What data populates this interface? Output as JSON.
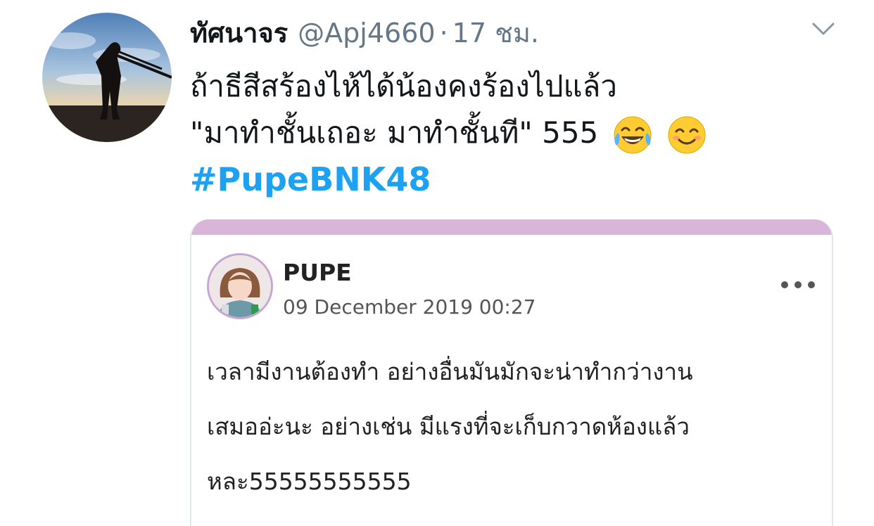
{
  "tweet": {
    "author": {
      "display_name": "ทัศนาจร",
      "handle": "@Apj4660",
      "separator": "·",
      "timestamp": "17 ชม."
    },
    "text_lines": [
      "ถ้าธีสีสร้องไห้ได้น้องคงร้องไปแล้ว",
      "\"มาทำชั้นเถอะ มาทำชั้นที\" 555"
    ],
    "emojis": [
      "face-with-tears-of-joy",
      "smiling-face-with-smiling-eyes"
    ],
    "hashtag": "#PupeBNK48",
    "hashtag_color": "#1da1f2"
  },
  "embedded_post": {
    "accent_color": "#d9b6d9",
    "author_name": "PUPE",
    "date": "09 December 2019 00:27",
    "body_lines": [
      "เวลามีงานต้องทำ อย่างอื่นมันมักจะน่าทำกว่างาน",
      "เสมออ่ะนะ อย่างเช่น มีแรงที่จะเก็บกวาดห้องแล้ว",
      "หละ55555555555"
    ]
  }
}
